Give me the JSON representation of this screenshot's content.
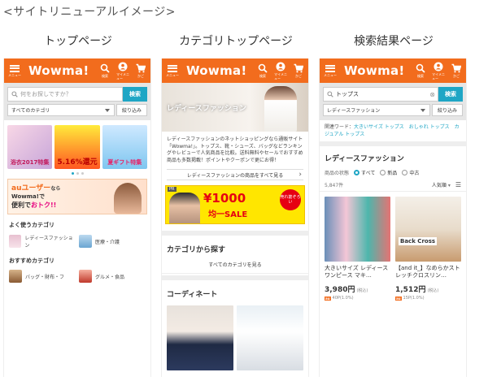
{
  "page_title": "<サイトリニューアルイメージ>",
  "columns": [
    {
      "label": "トップページ"
    },
    {
      "label": "カテゴリトップページ"
    },
    {
      "label": "検索結果ページ"
    }
  ],
  "header": {
    "logo": "Wowma!",
    "menu_label": "メニュー",
    "icon_labels": [
      "検索",
      "マイメニュー",
      "かご"
    ]
  },
  "top": {
    "search_placeholder": "何をお探しですか？",
    "search_button": "検索",
    "category_select": "すべてのカテゴリ",
    "filter_button": "絞り込み",
    "banners": [
      "浴衣2017特集",
      "5.16%還元",
      "夏ギフト特集"
    ],
    "au_banner": {
      "l1": "auユーザー",
      "l1b": "なら",
      "l2": "Wowma!で",
      "l3a": "便利で",
      "l3b": "おトク!!"
    },
    "frequent_heading": "よく使うカテゴリ",
    "frequent": [
      "レディースファッション",
      "医療・介護"
    ],
    "recommended_heading": "おすすめカテゴリ",
    "recommended": [
      "バッグ・財布・フ",
      "グルメ・食品"
    ]
  },
  "category": {
    "hero_label": "レディースファッション",
    "description": "レディースファッションのネットショッピングなら通販サイト「Wowma!」。トップス、靴・シューズ、バッグなどランキングやレビューで人気商品を比較。送料無料やセールでおすすめ商品も多数掲載！ポイントやクーポンで更にお得！",
    "see_all": "レディースファッションの商品をすべて見る",
    "pr": "PR",
    "sale_text": "¥1000",
    "sale_text2": "均一SALE",
    "sale_badge": "売れ筋ぞろい",
    "browse_heading": "カテゴリから探す",
    "browse_all": "すべてのカテゴリを見る",
    "coordinate_heading": "コーディネート"
  },
  "results": {
    "query": "トップス",
    "search_button": "検索",
    "category_select": "レディースファッション",
    "filter_button": "絞り込み",
    "related_label": "関連ワード：",
    "related_words": "大きいサイズ トップス　おしゃれ トップス　カジュアル トップス",
    "heading": "レディースファッション",
    "condition_label": "商品の状態",
    "conditions": [
      "すべて",
      "新品",
      "中古"
    ],
    "count": "5,847件",
    "sort": "人気順",
    "products": [
      {
        "name": "大きいサイズ レディース ワンピース マキ…",
        "price": "3,980円",
        "tax": "(税込)",
        "points": "40P(1.0%)"
      },
      {
        "name": "【and it_】なめらかストレッチクロスリン…",
        "price": "1,512円",
        "tax": "(税込)",
        "points": "15P(1.0%)",
        "image_text": "Back Cross"
      }
    ]
  },
  "colors": {
    "brand": "#f26c1d",
    "accent": "#1fa6c5"
  }
}
